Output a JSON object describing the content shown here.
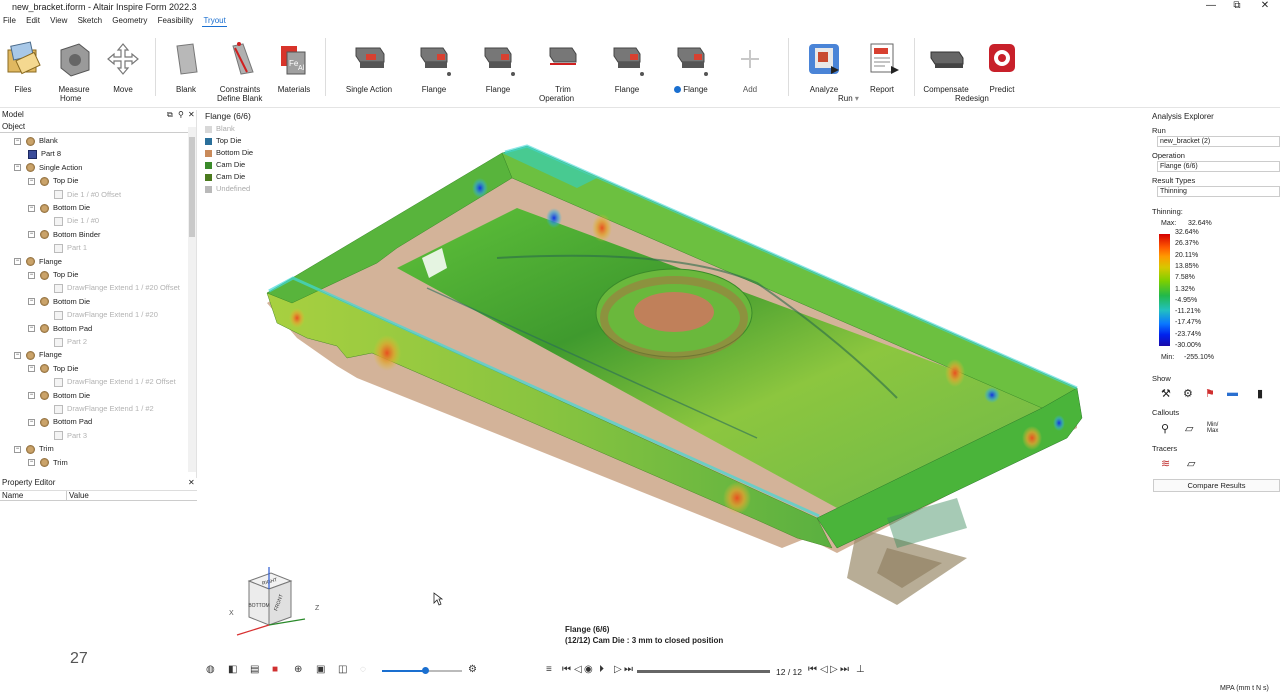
{
  "window": {
    "title": "new_bracket.iform - Altair Inspire Form 2022.3",
    "controls": [
      "—",
      "⧉",
      "✕"
    ]
  },
  "menu": [
    "File",
    "Edit",
    "View",
    "Sketch",
    "Geometry",
    "Feasibility",
    "Tryout"
  ],
  "menu_active": "Tryout",
  "ribbon": {
    "buttons": {
      "files": "Files",
      "measure": "Measure",
      "move": "Move",
      "blank": "Blank",
      "constraints": "Constraints",
      "materials": "Materials",
      "single_action": "Single Action",
      "flange1": "Flange",
      "flange2": "Flange",
      "trim": "Trim",
      "flange3": "Flange",
      "flange4": "Flange",
      "add": "Add",
      "analyze": "Analyze",
      "report": "Report",
      "compensate": "Compensate",
      "predict": "Predict"
    },
    "groups": {
      "home": "Home",
      "define_blank": "Define Blank",
      "operation": "Operation",
      "run": "Run",
      "redesign": "Redesign"
    }
  },
  "model_panel": {
    "title": "Model",
    "column": "Object",
    "items": [
      {
        "label": "Blank",
        "kind": "folder",
        "level": 1
      },
      {
        "label": "Part 8",
        "kind": "part",
        "level": 2
      },
      {
        "label": "Single Action",
        "kind": "folder",
        "level": 1
      },
      {
        "label": "Top Die",
        "kind": "folder",
        "level": 2
      },
      {
        "label": "Die 1 / #0 Offset",
        "kind": "dim",
        "level": 3
      },
      {
        "label": "Bottom Die",
        "kind": "folder",
        "level": 2
      },
      {
        "label": "Die 1 / #0",
        "kind": "dim",
        "level": 3
      },
      {
        "label": "Bottom Binder",
        "kind": "folder",
        "level": 2
      },
      {
        "label": "Part 1",
        "kind": "dim",
        "level": 3
      },
      {
        "label": "Flange",
        "kind": "folder",
        "level": 1
      },
      {
        "label": "Top Die",
        "kind": "folder",
        "level": 2
      },
      {
        "label": "DrawFlange Extend 1 / #20 Offset",
        "kind": "dim",
        "level": 3
      },
      {
        "label": "Bottom Die",
        "kind": "folder",
        "level": 2
      },
      {
        "label": "DrawFlange Extend 1 / #20",
        "kind": "dim",
        "level": 3
      },
      {
        "label": "Bottom Pad",
        "kind": "folder",
        "level": 2
      },
      {
        "label": "Part 2",
        "kind": "dim",
        "level": 3
      },
      {
        "label": "Flange",
        "kind": "folder",
        "level": 1
      },
      {
        "label": "Top Die",
        "kind": "folder",
        "level": 2
      },
      {
        "label": "DrawFlange Extend 1 / #2 Offset",
        "kind": "dim",
        "level": 3
      },
      {
        "label": "Bottom Die",
        "kind": "folder",
        "level": 2
      },
      {
        "label": "DrawFlange Extend 1 / #2",
        "kind": "dim",
        "level": 3
      },
      {
        "label": "Bottom Pad",
        "kind": "folder",
        "level": 2
      },
      {
        "label": "Part 3",
        "kind": "dim",
        "level": 3
      },
      {
        "label": "Trim",
        "kind": "folder",
        "level": 1
      },
      {
        "label": "Trim",
        "kind": "folder",
        "level": 2
      }
    ]
  },
  "property_editor": {
    "title": "Property Editor",
    "col_name": "Name",
    "col_value": "Value",
    "page_number": "27"
  },
  "viewport": {
    "legend_title": "Flange (6/6)",
    "legend": [
      {
        "label": "Blank",
        "color": "#d8d8d8",
        "dim": true
      },
      {
        "label": "Top Die",
        "color": "#2a6f9a",
        "dim": false
      },
      {
        "label": "Bottom Die",
        "color": "#c98a5a",
        "dim": false
      },
      {
        "label": "Cam Die",
        "color": "#3a8a2a",
        "dim": false
      },
      {
        "label": "Cam Die",
        "color": "#4b7a1e",
        "dim": false
      },
      {
        "label": "Undefined",
        "color": "#b9b9b9",
        "dim": true
      }
    ],
    "caption_line1": "Flange (6/6)",
    "caption_line2": "(12/12) Cam Die : 3 mm to closed position",
    "frame_counter": "12 / 12",
    "viewcube": {
      "top": "RIGHT",
      "front": "BOTTOM",
      "right": "FRONT"
    },
    "axes": {
      "x": "X",
      "z": "Z"
    }
  },
  "analysis_explorer": {
    "title": "Analysis Explorer",
    "run_label": "Run",
    "run_value": "new_bracket (2)",
    "operation_label": "Operation",
    "operation_value": "Flange (6/6)",
    "result_types_label": "Result Types",
    "result_type_value": "Thinning",
    "thinning_label": "Thinning:",
    "max_label": "Max:",
    "max_value": "32.64%",
    "min_label": "Min:",
    "min_value": "-255.10%",
    "scale": [
      "32.64%",
      "26.37%",
      "20.11%",
      "13.85%",
      "7.58%",
      "1.32%",
      "-4.95%",
      "-11.21%",
      "-17.47%",
      "-23.74%",
      "-30.00%"
    ],
    "show_label": "Show",
    "callouts_label": "Callouts",
    "minmax_label": "Min/ Max",
    "tracers_label": "Tracers",
    "compare_button": "Compare Results"
  },
  "status": {
    "units": "MPA (mm t N s)"
  }
}
